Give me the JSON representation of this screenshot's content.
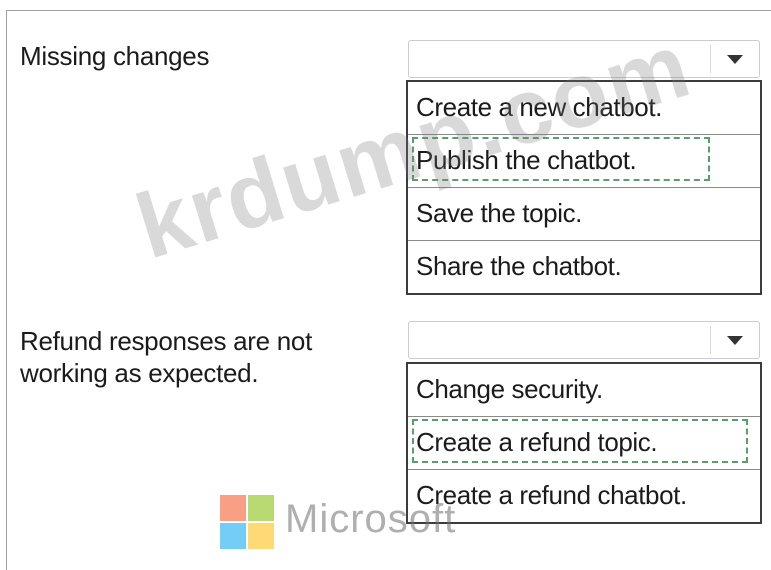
{
  "questions": [
    {
      "prompt": "Missing changes",
      "options": [
        "Create a new chatbot.",
        "Publish the chatbot.",
        "Save the topic.",
        "Share the chatbot."
      ],
      "selected_answer": "Publish the chatbot."
    },
    {
      "prompt": "Refund responses are not working as expected.",
      "options": [
        "Change security.",
        "Create a refund topic.",
        "Create a refund chatbot."
      ],
      "selected_answer": "Create a refund topic."
    }
  ],
  "watermark": {
    "text": "krdump.com",
    "logo_text": "Microsoft"
  },
  "colors": {
    "answer_highlight": "#5b9e6c",
    "border": "#3c3c3c"
  },
  "icons": {
    "dropdown": "chevron-down-icon",
    "logo": "microsoft-logo-icon"
  }
}
